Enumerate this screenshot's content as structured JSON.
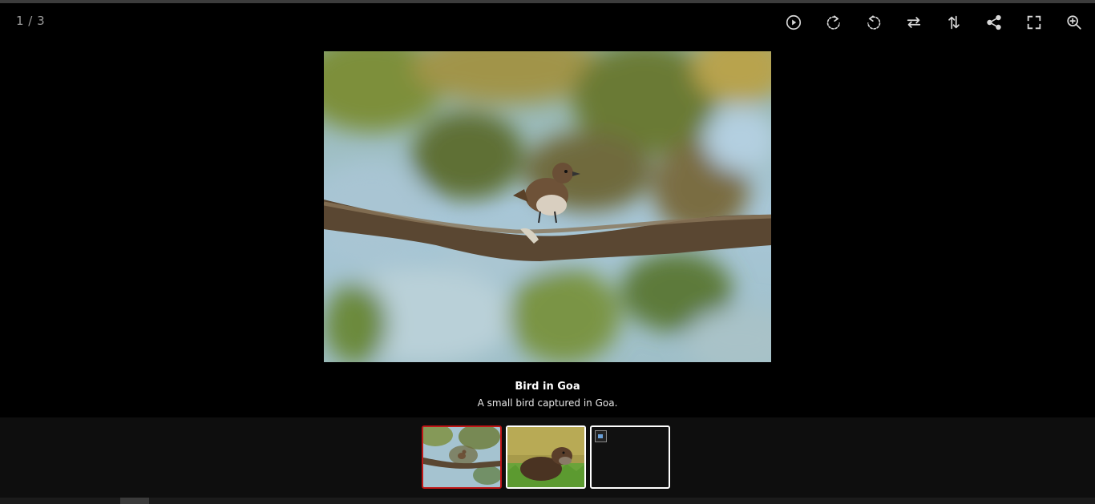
{
  "viewer": {
    "counter": "1 / 3",
    "toolbar": [
      {
        "name": "play-icon"
      },
      {
        "name": "rotate-right-icon"
      },
      {
        "name": "rotate-left-icon"
      },
      {
        "name": "flip-horizontal-icon"
      },
      {
        "name": "flip-vertical-icon"
      },
      {
        "name": "share-icon"
      },
      {
        "name": "fullscreen-icon"
      },
      {
        "name": "zoom-in-icon"
      }
    ],
    "caption": {
      "title": "Bird in Goa",
      "description": "A small bird captured in Goa."
    },
    "thumbnails": [
      {
        "subject": "bird-on-branch",
        "active": true
      },
      {
        "subject": "otter-on-grass",
        "active": false
      },
      {
        "subject": "broken-image",
        "active": false
      }
    ],
    "colors": {
      "background": "#000000",
      "thumbbar": "#0e0e0e",
      "active_border": "#c01616",
      "thumb_border": "#ffffff",
      "icon": "#d8d8d8"
    }
  }
}
